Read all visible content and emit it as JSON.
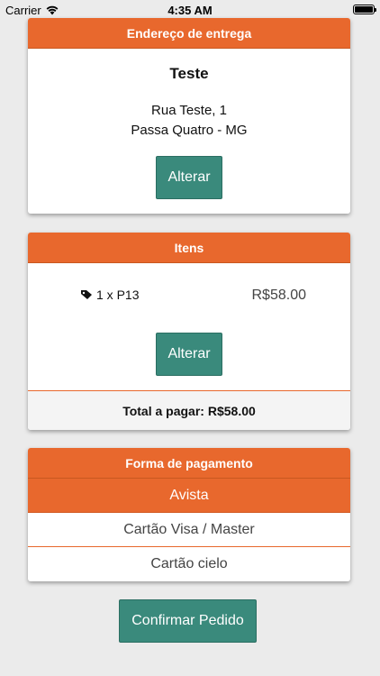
{
  "status_bar": {
    "carrier": "Carrier",
    "time": "4:35 AM"
  },
  "address": {
    "header": "Endereço de entrega",
    "name": "Teste",
    "street": "Rua Teste, 1",
    "city": "Passa Quatro - MG",
    "change_label": "Alterar"
  },
  "items": {
    "header": "Itens",
    "rows": [
      {
        "description": "1 x P13",
        "price": "R$58.00",
        "icon": "tag-icon"
      }
    ],
    "change_label": "Alterar",
    "total": "Total a pagar: R$58.00"
  },
  "payment": {
    "header": "Forma de pagamento",
    "options": [
      {
        "label": "Avista",
        "selected": true
      },
      {
        "label": "Cartão Visa / Master",
        "selected": false
      },
      {
        "label": "Cartão cielo",
        "selected": false
      }
    ]
  },
  "confirm_label": "Confirmar Pedido",
  "colors": {
    "accent": "#e8682d",
    "button": "#3a8a7c",
    "background": "#ebebeb"
  }
}
